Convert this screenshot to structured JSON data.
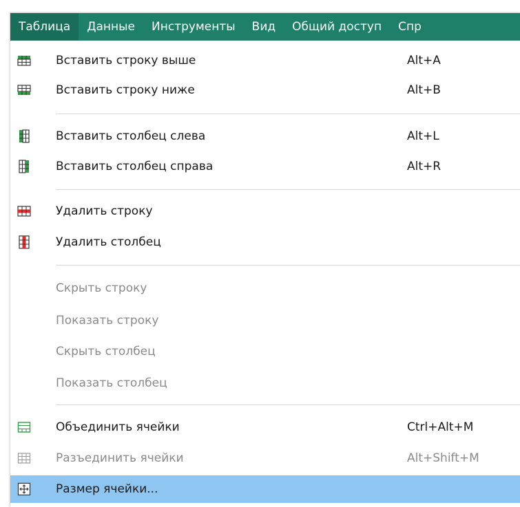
{
  "menubar": {
    "items": [
      "Таблица",
      "Данные",
      "Инструменты",
      "Вид",
      "Общий доступ",
      "Спр"
    ],
    "active": "Таблица",
    "color": "#1e8068"
  },
  "menu": {
    "items": [
      {
        "icon": "insert-row-above-icon",
        "label": "Вставить строку выше",
        "shortcut": "Alt+A",
        "enabled": true
      },
      {
        "icon": "insert-row-below-icon",
        "label": "Вставить строку ниже",
        "shortcut": "Alt+B",
        "enabled": true
      },
      {
        "icon": "insert-column-left-icon",
        "label": "Вставить столбец слева",
        "shortcut": "Alt+L",
        "enabled": true
      },
      {
        "icon": "insert-column-right-icon",
        "label": "Вставить столбец справа",
        "shortcut": "Alt+R",
        "enabled": true
      },
      {
        "icon": "delete-row-icon",
        "label": "Удалить строку",
        "shortcut": "",
        "enabled": true
      },
      {
        "icon": "delete-column-icon",
        "label": "Удалить столбец",
        "shortcut": "",
        "enabled": true
      },
      {
        "icon": "",
        "label": "Скрыть строку",
        "shortcut": "",
        "enabled": false
      },
      {
        "icon": "",
        "label": "Показать строку",
        "shortcut": "",
        "enabled": false
      },
      {
        "icon": "",
        "label": "Скрыть столбец",
        "shortcut": "",
        "enabled": false
      },
      {
        "icon": "",
        "label": "Показать столбец",
        "shortcut": "",
        "enabled": false
      },
      {
        "icon": "merge-cells-icon",
        "label": "Объединить ячейки",
        "shortcut": "Ctrl+Alt+M",
        "enabled": true
      },
      {
        "icon": "unmerge-cells-icon",
        "label": "Разъединить ячейки",
        "shortcut": "Alt+Shift+M",
        "enabled": false
      },
      {
        "icon": "cell-size-icon",
        "label": "Размер ячейки...",
        "shortcut": "",
        "enabled": true,
        "highlighted": true
      }
    ],
    "highlight_color": "#8ec6f1"
  }
}
